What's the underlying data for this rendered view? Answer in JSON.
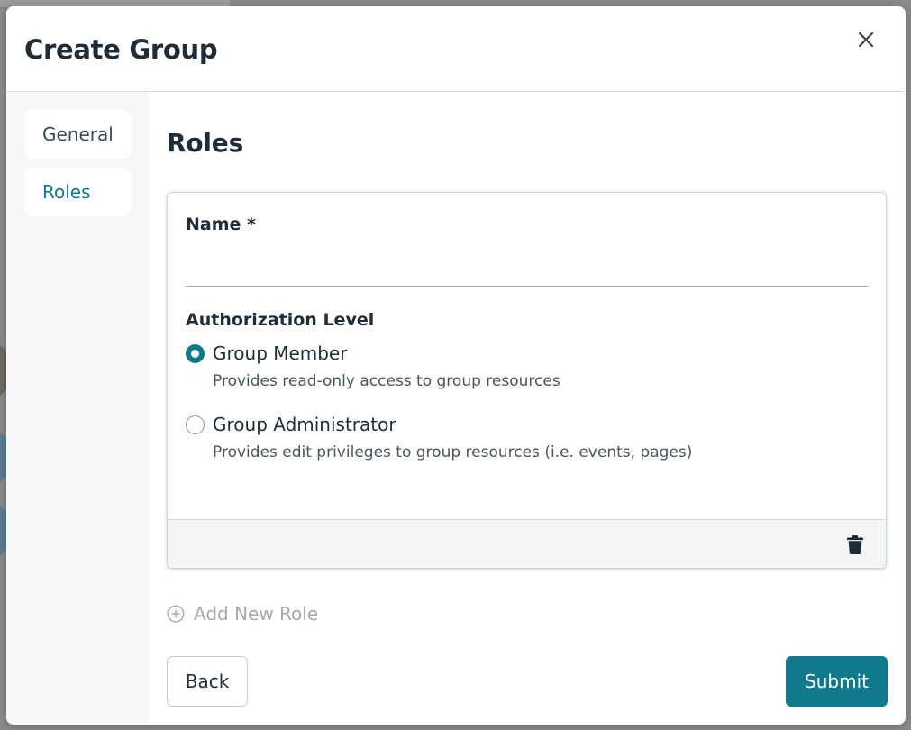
{
  "modal": {
    "title": "Create Group"
  },
  "sidebar": {
    "items": [
      {
        "label": "General",
        "active": false
      },
      {
        "label": "Roles",
        "active": true
      }
    ]
  },
  "roles": {
    "title": "Roles",
    "card": {
      "name_label": "Name *",
      "name_value": "",
      "auth_label": "Authorization Level",
      "options": [
        {
          "label": "Group Member",
          "description": "Provides read-only access to group resources",
          "selected": true
        },
        {
          "label": "Group Administrator",
          "description": "Provides edit privileges to group resources (i.e. events, pages)",
          "selected": false
        }
      ]
    },
    "add_role_label": "Add New Role"
  },
  "actions": {
    "back_label": "Back",
    "submit_label": "Submit"
  },
  "colors": {
    "accent": "#0f7a89",
    "text": "#1f2d38",
    "muted": "#a3a9ae"
  },
  "icons": {
    "close": "close-icon",
    "trash": "trash-icon",
    "add": "plus-circle-icon"
  }
}
